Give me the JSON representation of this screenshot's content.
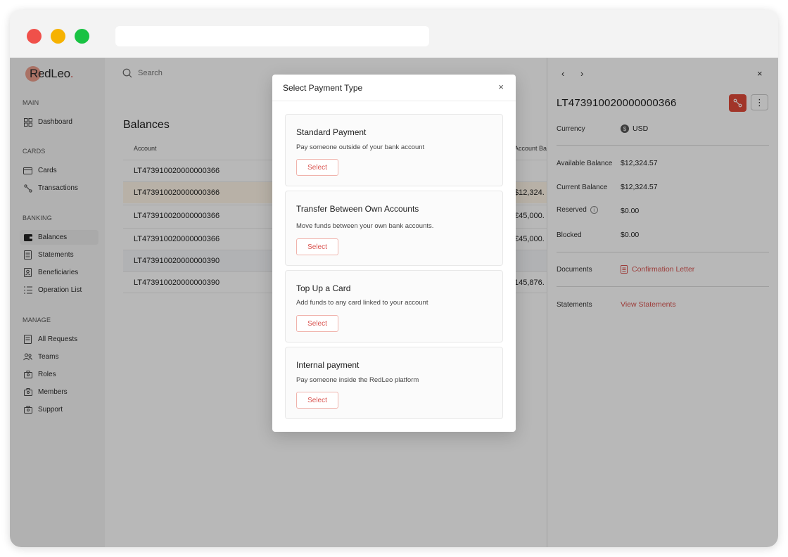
{
  "brand": {
    "name": "RedLeo",
    "accent": "#d9534f"
  },
  "search": {
    "placeholder": "Search"
  },
  "sidebar": {
    "sections": [
      {
        "title": "MAIN",
        "items": [
          {
            "label": "Dashboard",
            "icon": "grid-icon"
          }
        ]
      },
      {
        "title": "CARDS",
        "items": [
          {
            "label": "Cards",
            "icon": "card-icon"
          },
          {
            "label": "Transactions",
            "icon": "transactions-icon"
          }
        ]
      },
      {
        "title": "BANKING",
        "items": [
          {
            "label": "Balances",
            "icon": "wallet-icon",
            "active": true
          },
          {
            "label": "Statements",
            "icon": "document-icon"
          },
          {
            "label": "Beneficiaries",
            "icon": "beneficiaries-icon"
          },
          {
            "label": "Operation List",
            "icon": "list-icon"
          }
        ]
      },
      {
        "title": "MANAGE",
        "items": [
          {
            "label": "All Requests",
            "icon": "requests-icon"
          },
          {
            "label": "Teams",
            "icon": "teams-icon"
          },
          {
            "label": "Roles",
            "icon": "roles-icon"
          },
          {
            "label": "Members",
            "icon": "members-icon"
          },
          {
            "label": "Support",
            "icon": "support-icon"
          }
        ]
      }
    ]
  },
  "main": {
    "title": "Balances",
    "columns": {
      "account": "Account",
      "balance": "Account Balance"
    },
    "rows": [
      {
        "account": "LT473910020000000366",
        "balance": ""
      },
      {
        "account": "LT473910020000000366",
        "balance": "$12,324."
      },
      {
        "account": "LT473910020000000366",
        "balance": "€45,000."
      },
      {
        "account": "LT473910020000000366",
        "balance": "€45,000."
      },
      {
        "account": "LT473910020000000390",
        "balance": ""
      },
      {
        "account": "LT473910020000000390",
        "balance": "145,876."
      }
    ]
  },
  "detail": {
    "account": "LT473910020000000366",
    "currency_label": "Currency",
    "currency_value": "USD",
    "available_label": "Available Balance",
    "available_value": "$12,324.57",
    "current_label": "Current Balance",
    "current_value": "$12,324.57",
    "reserved_label": "Reserved",
    "reserved_value": "$0.00",
    "blocked_label": "Blocked",
    "blocked_value": "$0.00",
    "documents_label": "Documents",
    "documents_link": "Confirmation Letter",
    "statements_label": "Statements",
    "statements_link": "View Statements"
  },
  "modal": {
    "title": "Select Payment Type",
    "options": [
      {
        "title": "Standard Payment",
        "description": "Pay someone outside of your bank account",
        "button": "Select"
      },
      {
        "title": "Transfer Between Own Accounts",
        "description": "Move funds between your own bank accounts.",
        "button": "Select"
      },
      {
        "title": "Top Up a Card",
        "description": "Add funds to any card linked to your account",
        "button": "Select"
      },
      {
        "title": "Internal payment",
        "description": "Pay someone inside the RedLeo platform",
        "button": "Select"
      }
    ]
  }
}
